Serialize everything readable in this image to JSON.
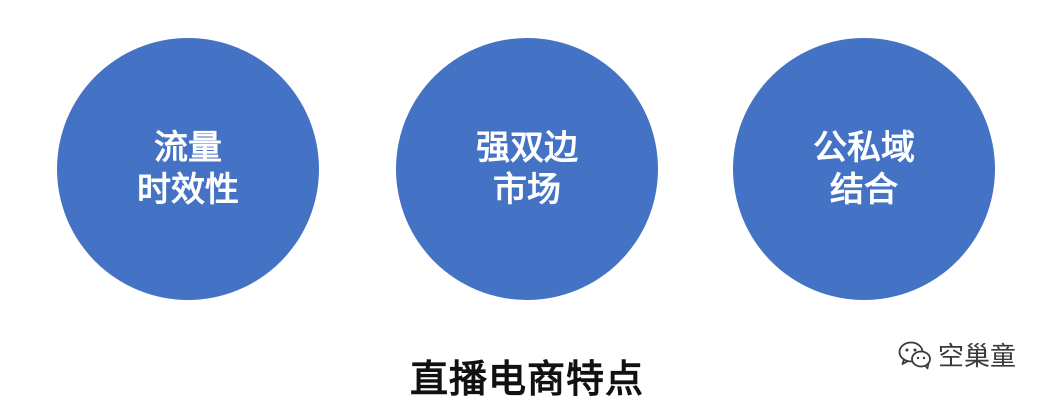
{
  "colors": {
    "circle_fill": "#4472C4",
    "circle_text": "#FFFFFF",
    "title_text": "#111111",
    "watermark_text": "#3A3A3A"
  },
  "circles": [
    {
      "line1": "流量",
      "line2": "时效性"
    },
    {
      "line1": "强双边",
      "line2": "市场"
    },
    {
      "line1": "公私域",
      "line2": "结合"
    }
  ],
  "title": "直播电商特点",
  "watermark": {
    "icon": "wechat-icon",
    "text": "空巢童"
  }
}
